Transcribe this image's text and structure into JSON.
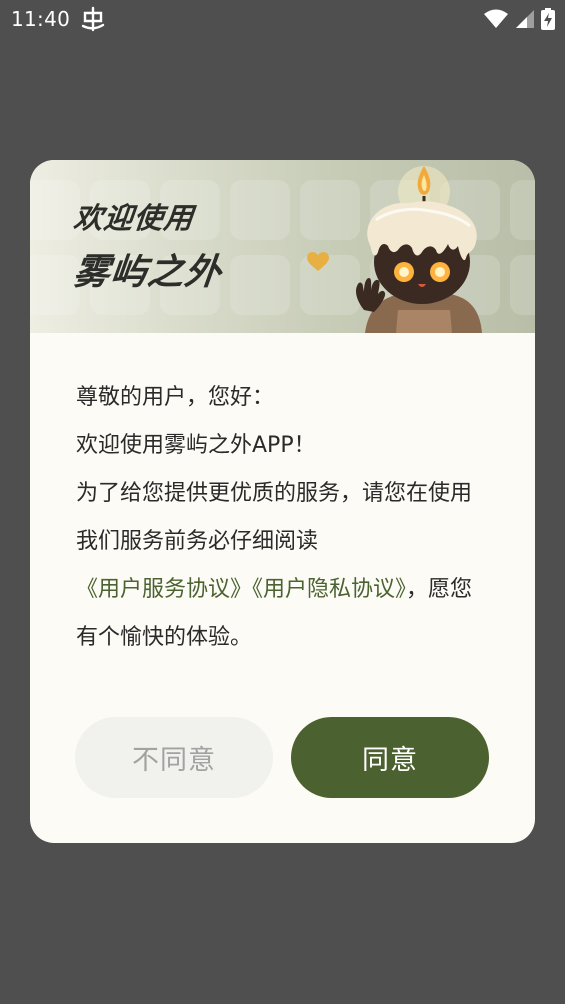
{
  "status_bar": {
    "time": "11:40",
    "app_icon": "bug-icon",
    "icons": [
      "wifi-icon",
      "signal-icon",
      "battery-charging-icon"
    ]
  },
  "dialog": {
    "banner": {
      "title_line1": "欢迎使用",
      "title_line2": "雾屿之外",
      "illustration": "candle-mascot-illustration",
      "heart": "heart-icon"
    },
    "greeting": "尊敬的用户，您好：",
    "welcome": "欢迎使用雾屿之外APP！",
    "paragraph": {
      "intro": "为了给您提供更优质的服务，请您在使用我们服务前务必仔细阅读",
      "link_terms": "《用户服务协议》",
      "link_privacy": "《用户隐私协议》",
      "outro": "，愿您有个愉快的体验。"
    },
    "buttons": {
      "decline": "不同意",
      "accept": "同意"
    }
  },
  "colors": {
    "screen_background": "#4f4f4f",
    "dialog_background": "#fdfbf6",
    "accent_green": "#4c6130",
    "link_green": "#4b6330",
    "decline_background": "#f1f1ed",
    "decline_text": "#a2a2a2"
  }
}
